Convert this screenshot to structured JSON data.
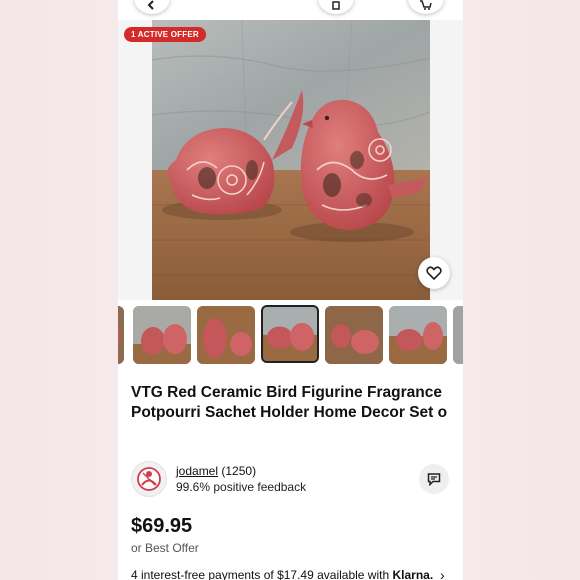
{
  "listing": {
    "offer_badge": "1 ACTIVE OFFER",
    "title": "VTG Red Ceramic Bird Figurine Fragrance Potpourri Sachet Holder Home Decor Set o",
    "price": "$69.95",
    "best_offer": "or Best Offer",
    "installments": "4 interest-free payments of $17.49 available with",
    "installments_brand": "Klarna."
  },
  "seller": {
    "username": "jodamel",
    "rating_count": "(1250)",
    "feedback": "99.6% positive feedback"
  },
  "thumbnails": {
    "count": 7,
    "selected_index": 3
  },
  "colors": {
    "badge_red": "#d42a2a",
    "ceramic_pink": "#c8585a",
    "wood": "#9a6a43",
    "stone_wall": "#a9aeae"
  },
  "icons": {
    "back": "chevron-left-icon",
    "share": "share-icon",
    "cart": "cart-icon",
    "watch": "heart-icon",
    "message": "message-icon",
    "seller_avatar": "seller-avatar-icon",
    "installments_next": "chevron-right-icon"
  }
}
